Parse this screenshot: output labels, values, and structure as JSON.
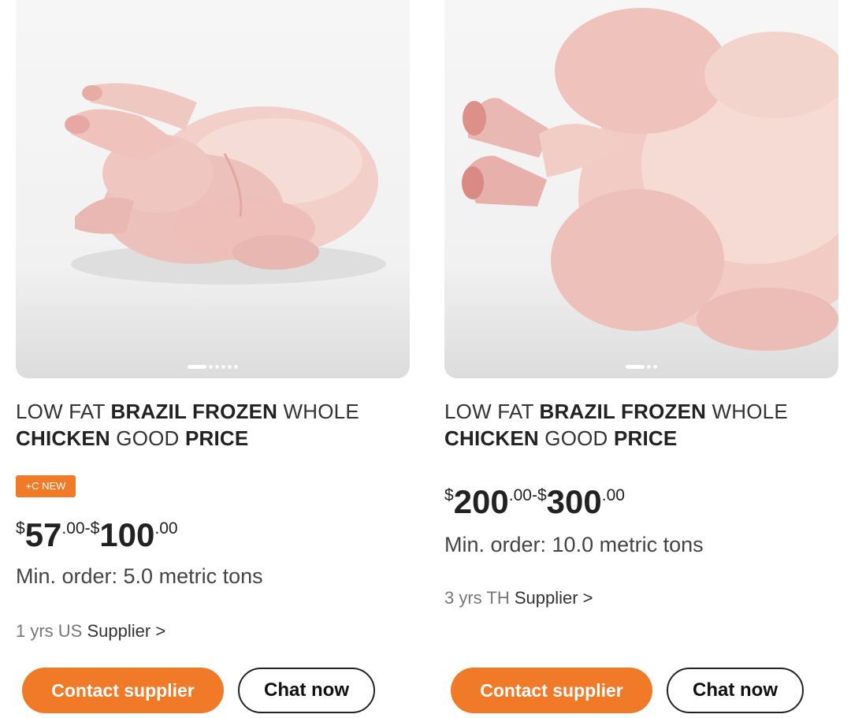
{
  "products": [
    {
      "title_parts": [
        {
          "text": "LOW FAT ",
          "bold": false
        },
        {
          "text": "BRAZIL FROZEN",
          "bold": true
        },
        {
          "text": " WHOLE ",
          "bold": false
        },
        {
          "text": "CHICKEN",
          "bold": true
        },
        {
          "text": " GOOD ",
          "bold": false
        },
        {
          "text": "PRICE",
          "bold": true
        }
      ],
      "badge": "+C NEW",
      "price": {
        "cur1": "$",
        "int1": "57",
        "dec1": ".00",
        "sep": "-",
        "cur2": "$",
        "int2": "100",
        "dec2": ".00"
      },
      "min_order": "Min. order: 5.0 metric tons",
      "supplier": {
        "meta": "1 yrs US",
        "link": "Supplier >"
      },
      "contact_label": "Contact supplier",
      "chat_label": "Chat now",
      "image_count": 6,
      "active_image": 0,
      "icon": "whole-chicken-photo"
    },
    {
      "title_parts": [
        {
          "text": "LOW FAT ",
          "bold": false
        },
        {
          "text": "BRAZIL FROZEN",
          "bold": true
        },
        {
          "text": " WHOLE ",
          "bold": false
        },
        {
          "text": "CHICKEN",
          "bold": true
        },
        {
          "text": " GOOD ",
          "bold": false
        },
        {
          "text": "PRICE",
          "bold": true
        }
      ],
      "badge": "",
      "price": {
        "cur1": "$",
        "int1": "200",
        "dec1": ".00",
        "sep": "-",
        "cur2": "$",
        "int2": "300",
        "dec2": ".00"
      },
      "min_order": "Min. order: 10.0 metric tons",
      "supplier": {
        "meta": "3 yrs TH",
        "link": "Supplier >"
      },
      "contact_label": "Contact supplier",
      "chat_label": "Chat now",
      "image_count": 3,
      "active_image": 0,
      "icon": "whole-chicken-photo"
    }
  ],
  "colors": {
    "accent": "#f07a28",
    "text": "#222222",
    "muted": "#777777",
    "image_bg": "#f1f1f1"
  }
}
